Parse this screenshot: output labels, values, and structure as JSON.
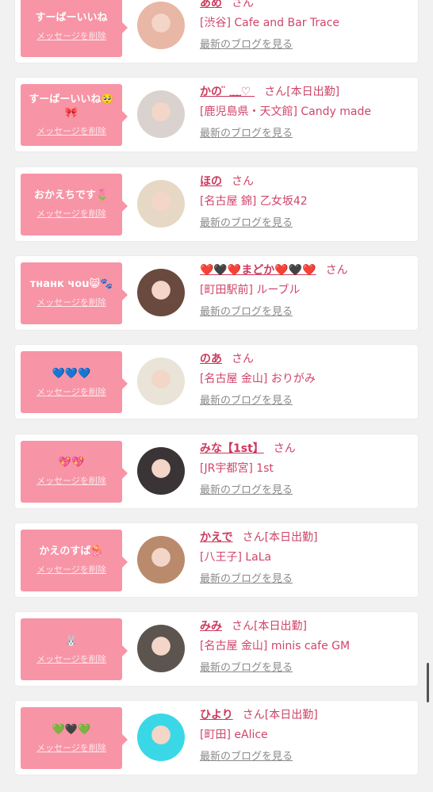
{
  "delete_label": "メッセージを削除",
  "blog_label": "最新のブログを見る",
  "honorific": "さん",
  "items": [
    {
      "message": "すーばーいいね",
      "name": "あめ",
      "status": "",
      "shop": "[渋谷] Cafe and Bar Trace"
    },
    {
      "message": "すーばーいいね🥺🎀",
      "name": "かの ̈ ﹏♡ ",
      "status": "[本日出勤]",
      "shop": "[鹿児島県・天文館] Candy made"
    },
    {
      "message": "おかえちです🌷",
      "name": "ほの",
      "status": "",
      "shop": "[名古屋 錦] 乙女坂42"
    },
    {
      "message": "тнанк чou😸🐾",
      "name": "❤️🖤❤️まどか❤️🖤❤️",
      "status": "",
      "shop": "[町田駅前] ルーブル"
    },
    {
      "message": "💙💙💙",
      "name": "のあ",
      "status": "",
      "shop": "[名古屋 金山] おりがみ"
    },
    {
      "message": "💖💖",
      "name": "みな【1st】",
      "status": "",
      "shop": "[JR宇都宮] 1st"
    },
    {
      "message": "かえのすば🪼",
      "name": "かえで",
      "status": "[本日出勤]",
      "shop": "[八王子] LaLa"
    },
    {
      "message": "🐰",
      "name": "みみ",
      "status": "[本日出勤]",
      "shop": "[名古屋 金山] minis cafe GM"
    },
    {
      "message": "💚🖤💚",
      "name": "ひより",
      "status": "[本日出勤]",
      "shop": "[町田] eAlice"
    }
  ],
  "avatar_colors": [
    "#e8b7a6",
    "#d9d2cf",
    "#e6d8c4",
    "#6a4a3e",
    "#e9e3d8",
    "#3a3436",
    "#b98a6c",
    "#5c544e",
    "#3ad8e6"
  ],
  "colors": {
    "bubble": "#f794a6",
    "name": "#cc3a5e",
    "background": "#f1f1f1"
  }
}
